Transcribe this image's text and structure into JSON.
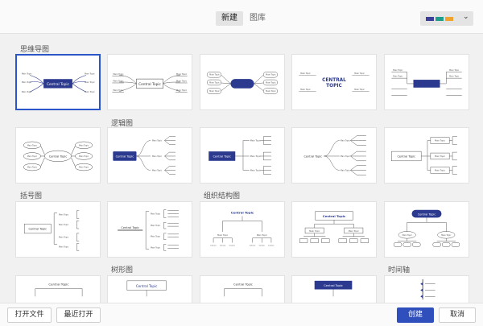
{
  "tabs": {
    "new": "新建",
    "gallery": "图库"
  },
  "theme": {
    "swatches": [
      "#3b3f9a",
      "#1f9c8a",
      "#f1a330"
    ],
    "icon": "chevron-down-icon"
  },
  "sections": {
    "mindmap": "思维导图",
    "logic": "逻辑图",
    "brace": "括号图",
    "org": "组织结构图",
    "tree": "树形图",
    "timeline": "时间轴"
  },
  "thumb_text": {
    "central": "Central Topic",
    "central_upper_1": "CENTRAL",
    "central_upper_2": "TOPIC",
    "main": "Main Topic",
    "sub": "Subtopic"
  },
  "colors": {
    "accent": "#2f4fbd",
    "thumb_navy": "#2b3a8f",
    "selected_border": "#2b56c9"
  },
  "footer": {
    "open_file": "打开文件",
    "recent": "最近打开",
    "create": "创建",
    "cancel": "取消"
  }
}
